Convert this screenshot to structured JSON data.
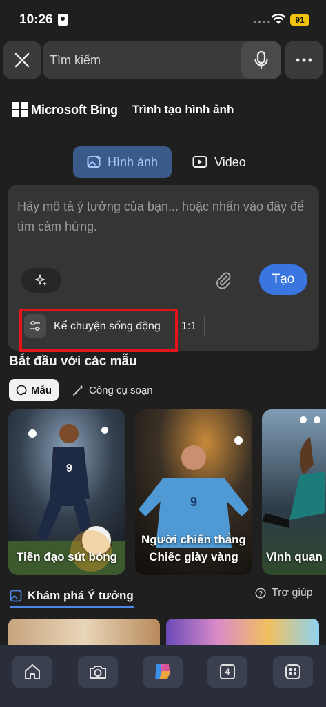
{
  "status_bar": {
    "time": "10:26",
    "battery": "91"
  },
  "search": {
    "placeholder": "Tìm kiếm"
  },
  "brand": {
    "name": "Microsoft Bing",
    "product": "Trình tạo hình ảnh"
  },
  "mode_tabs": [
    {
      "label": "Hình ảnh",
      "active": true
    },
    {
      "label": "Video",
      "active": false
    }
  ],
  "prompt": {
    "placeholder": "Hãy mô tả ý tưởng của bạn... hoặc nhấn vào đây để tìm cảm hứng.",
    "create_label": "Tạo",
    "style_label": "Kể chuyện sống động",
    "ratio_label": "1:1"
  },
  "templates": {
    "title": "Bắt đầu với các mẫu",
    "tabs": [
      {
        "label": "Mẫu",
        "active": true
      },
      {
        "label": "Công cụ soạn",
        "active": false
      }
    ],
    "cards": [
      {
        "label": "Tiền đạo sút bóng"
      },
      {
        "label": "Người chiến thắng Chiếc giày vàng"
      },
      {
        "label": "Vinh quan m"
      }
    ]
  },
  "explore": {
    "tab_label": "Khám phá Ý tưởng",
    "help_label": "Trợ giúp"
  },
  "bottom_nav": {
    "tab_count": "4"
  },
  "colors": {
    "accent": "#3a76e0",
    "highlight": "#e5141b",
    "background": "#1f1f1f"
  }
}
